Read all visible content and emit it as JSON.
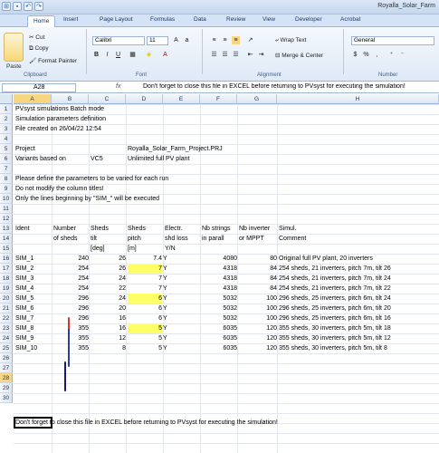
{
  "window": {
    "title": "Royalla_Solar_Farm"
  },
  "tabs": [
    "Home",
    "Insert",
    "Page Layout",
    "Formulas",
    "Data",
    "Review",
    "View",
    "Developer",
    "Acrobat"
  ],
  "ribbon": {
    "clipboard": {
      "paste": "Paste",
      "cut": "Cut",
      "copy": "Copy",
      "format_painter": "Format Painter",
      "label": "Clipboard"
    },
    "font": {
      "name": "Calibri",
      "size": "11",
      "label": "Font"
    },
    "alignment": {
      "wrap": "Wrap Text",
      "merge": "Merge & Center",
      "label": "Alignment"
    },
    "number": {
      "format": "General",
      "label": "Number"
    }
  },
  "formula_bar": {
    "name_box": "A28",
    "fx": "fx",
    "content": "Don't forget to close this file in EXCEL before returning to PVsyst for executing the simulation!"
  },
  "columns": [
    "A",
    "B",
    "C",
    "D",
    "E",
    "F",
    "G",
    "H"
  ],
  "rows": [
    "1",
    "2",
    "3",
    "4",
    "5",
    "6",
    "7",
    "8",
    "9",
    "10",
    "11",
    "12",
    "13",
    "14",
    "15",
    "16",
    "17",
    "18",
    "19",
    "20",
    "21",
    "22",
    "23",
    "24",
    "25",
    "26",
    "27",
    "28",
    "29",
    "30"
  ],
  "sheet": {
    "r1": "PVsyst simulations Batch mode",
    "r2": "Simulation parameters definition",
    "r3": "File created on 26/04/22 12:54",
    "r5a": "Project",
    "r5d": "Royalla_Solar_Farm_Project.PRJ",
    "r6a": "Variants based on",
    "r6c": "VC5",
    "r6d": "Unlimited full PV plant",
    "r8": "Please define the parameters to be varied for each run",
    "r9": "Do not modify the column titles!",
    "r10": "Only the lines beginning by \"SIM_\" will be executed",
    "h12": [
      "Ident",
      "Number",
      "Sheds",
      "Sheds",
      "Electr.",
      "Nb strings",
      "Nb inverter",
      "Simul."
    ],
    "h13": [
      "",
      "of sheds",
      "tilt",
      "pitch",
      "shd loss",
      "in parall",
      "or MPPT",
      "Comment"
    ],
    "h14": [
      "",
      "",
      "[deg]",
      "[m]",
      "Y/N",
      "",
      "",
      ""
    ],
    "data": [
      [
        "SIM_1",
        "240",
        "26",
        "7.4",
        "Y",
        "4080",
        "80",
        "Original full PV plant, 20 inverters"
      ],
      [
        "SIM_2",
        "254",
        "26",
        "7",
        "Y",
        "4318",
        "84",
        "254 sheds, 21 inverters, pitch 7m, tilt 26"
      ],
      [
        "SIM_3",
        "254",
        "24",
        "7",
        "Y",
        "4318",
        "84",
        "254 sheds, 21 inverters, pitch 7m, tilt 24"
      ],
      [
        "SIM_4",
        "254",
        "22",
        "7",
        "Y",
        "4318",
        "84",
        "254 sheds, 21 inverters, pitch 7m, tilt 22"
      ],
      [
        "SIM_5",
        "296",
        "24",
        "6",
        "Y",
        "5032",
        "100",
        "296 sheds, 25 inverters, pitch 6m, tilt 24"
      ],
      [
        "SIM_6",
        "296",
        "20",
        "6",
        "Y",
        "5032",
        "100",
        "296 sheds, 25 inverters, pitch 6m, tilt 20"
      ],
      [
        "SIM_7",
        "296",
        "16",
        "6",
        "Y",
        "5032",
        "100",
        "296 sheds, 25 inverters, pitch 6m, tilt 16"
      ],
      [
        "SIM_8",
        "355",
        "16",
        "5",
        "Y",
        "6035",
        "120",
        "355 sheds, 30 inverters, pitch 5m, tilt 18"
      ],
      [
        "SIM_9",
        "355",
        "12",
        "5",
        "Y",
        "6035",
        "120",
        "355 sheds, 30 inverters, pitch 5m, tilt 12"
      ],
      [
        "SIM_10",
        "355",
        "8",
        "5",
        "Y",
        "6035",
        "120",
        "355 sheds, 30 inverters, pitch 5m, tilt 8"
      ]
    ],
    "r28": "Don't forget to close this file in EXCEL before returning to PVsyst for executing the simulation!"
  },
  "colors": {
    "highlight": "#ffff66",
    "red_bar": "#e03030",
    "blue_bar": "#2a3fa0"
  }
}
